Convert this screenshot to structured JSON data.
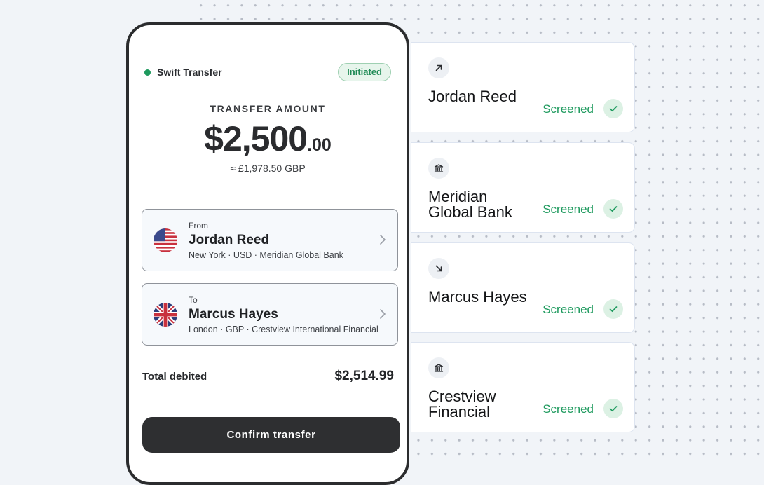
{
  "transfer": {
    "brand": "Swift Transfer",
    "status": "Initiated",
    "amount_label": "TRANSFER AMOUNT",
    "amount_main": "$2,500",
    "amount_cents": ".00",
    "amount_converted": "≈ £1,978.50 GBP",
    "from": {
      "direction": "From",
      "name": "Jordan Reed",
      "details": "New York · USD · Meridian Global Bank",
      "flag_icon": "us-flag-icon"
    },
    "to": {
      "direction": "To",
      "name": "Marcus Hayes",
      "details": "London · GBP · Crestview International Financial",
      "flag_icon": "uk-flag-icon"
    },
    "total_label": "Total debited",
    "total_value": "$2,514.99",
    "confirm_label": "Confirm transfer"
  },
  "screening": [
    {
      "icon": "arrow-up-right-icon",
      "name": "Jordan Reed",
      "status": "Screened"
    },
    {
      "icon": "bank-icon",
      "name": "Meridian Global Bank",
      "status": "Screened"
    },
    {
      "icon": "arrow-down-right-icon",
      "name": "Marcus Hayes",
      "status": "Screened"
    },
    {
      "icon": "bank-icon",
      "name": "Crestview Financial",
      "status": "Screened"
    }
  ],
  "colors": {
    "accent_green": "#1e9a5e",
    "button_dark": "#2e2f31",
    "background": "#f1f4f8"
  }
}
